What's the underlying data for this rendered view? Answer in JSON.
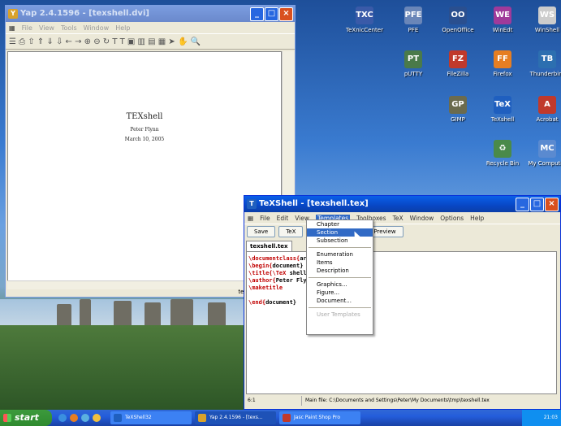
{
  "desktop_icons": [
    {
      "name": "TeXnicCenter",
      "glyph": "TXC",
      "color": "#3a5aa8"
    },
    {
      "name": "PFE",
      "glyph": "PFE",
      "color": "#6a86b8"
    },
    {
      "name": "OpenOffice",
      "glyph": "OO",
      "color": "#2a4f8f"
    },
    {
      "name": "WinEdt",
      "glyph": "WE",
      "color": "#a03a9a"
    },
    {
      "name": "WinShell",
      "glyph": "WS",
      "color": "#cccccc"
    },
    {
      "name": "pUTTY",
      "glyph": "PT",
      "color": "#4a7a4a"
    },
    {
      "name": "FileZilla",
      "glyph": "FZ",
      "color": "#c0392b"
    },
    {
      "name": "Firefox",
      "glyph": "FF",
      "color": "#e67e22"
    },
    {
      "name": "Thunderbird",
      "glyph": "TB",
      "color": "#2c6fb0"
    },
    {
      "name": "GIMP",
      "glyph": "GP",
      "color": "#6b6b4e"
    },
    {
      "name": "TeXshell",
      "glyph": "TeX",
      "color": "#1f5fbf"
    },
    {
      "name": "Acrobat",
      "glyph": "A",
      "color": "#c0392b"
    },
    {
      "name": "Recycle Bin",
      "glyph": "♻",
      "color": "#4a8a4a"
    },
    {
      "name": "My Computer",
      "glyph": "MC",
      "color": "#5a8ad0"
    }
  ],
  "yap": {
    "title": "Yap 2.4.1596 - [texshell.dvi]",
    "menu": [
      "File",
      "View",
      "Tools",
      "Window",
      "Help"
    ],
    "toolbar_glyphs": "☰ ⎙ ⇧ ⇑ ⇓ ⇩ ← → ⊕ ⊖ ↻ T T ▣ ▥ ▤ ▦ ➤ ✋ 🔍",
    "doc": {
      "title": "T",
      "title_rest": "EXshell",
      "author": "Peter Flynn",
      "date": "March 10, 2005"
    },
    "status": "texshell.tex L:5"
  },
  "texshell": {
    "title": "TeXShell - [texshell.tex]",
    "menu": [
      "File",
      "Edit",
      "View",
      "Templates",
      "Toolboxes",
      "TeX",
      "Window",
      "Options",
      "Help"
    ],
    "toolbar": {
      "save": "Save",
      "tex": "TeX",
      "preview": "Preview"
    },
    "tab": "texshell.tex",
    "lines": [
      {
        "kw": "\\documentclass{",
        "arg": "article}"
      },
      {
        "kw": "\\begin{",
        "arg": "document}"
      },
      {
        "kw": "\\title{\\TeX ",
        "arg": "shell}"
      },
      {
        "kw": "\\author{",
        "arg": "Peter Flynn}"
      },
      {
        "kw": "\\maketitle",
        "arg": ""
      },
      {
        "kw": "",
        "arg": ""
      },
      {
        "kw": "\\end{",
        "arg": "document}"
      }
    ],
    "status_pos": "6:1",
    "status_file": "Main file: C:\\Documents and Settings\\Peter\\My Documents\\tmp\\texshell.tex"
  },
  "templates_menu": {
    "items": [
      "Chapter",
      "Section",
      "Subsection"
    ],
    "items2": [
      "Enumeration",
      "Items",
      "Description"
    ],
    "items3": [
      "Graphics...",
      "Figure...",
      "Document..."
    ],
    "items4": [
      "User Templates"
    ],
    "hovered": "Section"
  },
  "taskbar": {
    "start": "start",
    "tasks": [
      {
        "label": "TeXShell32",
        "color": "#1f5fbf"
      },
      {
        "label": "Yap 2.4.1596 - [texs...",
        "color": "#d9a22a"
      },
      {
        "label": "Jasc Paint Shop Pro",
        "color": "#c0392b"
      }
    ],
    "clock": "21:03"
  }
}
